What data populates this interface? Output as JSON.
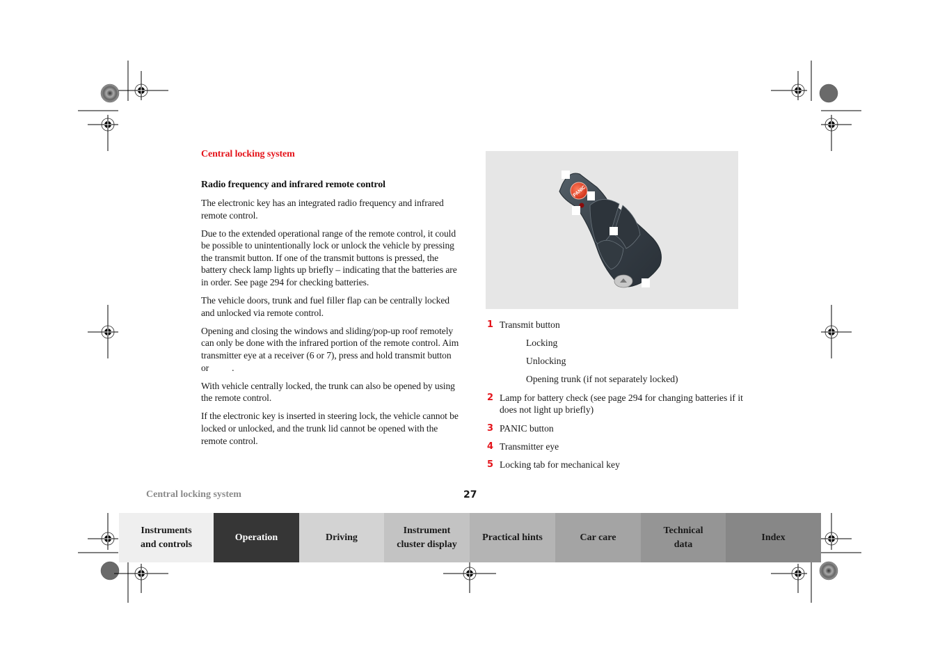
{
  "section_title": "Central locking system",
  "subheading": "Radio frequency and infrared remote control",
  "paragraphs": [
    "The electronic key has an integrated radio frequency and infrared remote control.",
    "Due to the extended operational range of the remote control, it could be possible to unintentionally lock or unlock the vehicle by pressing the transmit button. If one of the transmit buttons is pressed, the battery check lamp lights up briefly – indicating that the batteries are in order. See page 294 for checking batteries.",
    "The vehicle doors, trunk and fuel filler flap can be centrally locked and unlocked via remote control.",
    "Opening and closing the windows and sliding/pop-up roof remotely can only be done with the infrared portion of the remote control. Aim transmitter eye at a receiver (6 or 7), press and hold transmit button",
    "With vehicle centrally locked, the trunk can also be opened by using the remote control.",
    "If the electronic key is inserted in steering lock, the vehicle cannot be locked or unlocked, and the trunk lid cannot be opened with the remote control."
  ],
  "paragraph4_tail": "or          .",
  "figure": {
    "panic_label": "PANIC",
    "background": "#e6e6e6",
    "key_color": "#3a434c",
    "panic_color": "#e8482e"
  },
  "legend": [
    {
      "num": "1",
      "text": "Transmit button",
      "sub": [
        "Locking",
        "Unlocking",
        "Opening trunk (if not separately locked)"
      ]
    },
    {
      "num": "2",
      "text": "Lamp for battery check (see page 294 for changing batteries if it does not light up briefly)"
    },
    {
      "num": "3",
      "text": "PANIC button"
    },
    {
      "num": "4",
      "text": "Transmitter eye"
    },
    {
      "num": "5",
      "text": "Locking tab for mechanical key"
    }
  ],
  "footer": {
    "running_title": "Central locking system",
    "page_number": "27"
  },
  "nav_tabs": [
    {
      "label": "Instruments and controls",
      "line1": "Instruments",
      "line2": "and controls",
      "bg": "#efefef",
      "fg": "#1a1a1a",
      "active": false
    },
    {
      "label": "Operation",
      "line1": "Operation",
      "line2": "",
      "bg": "#363636",
      "fg": "#ffffff",
      "active": true
    },
    {
      "label": "Driving",
      "line1": "Driving",
      "line2": "",
      "bg": "#d3d3d3",
      "fg": "#1a1a1a",
      "active": false
    },
    {
      "label": "Instrument cluster display",
      "line1": "Instrument",
      "line2": "cluster display",
      "bg": "#c3c3c3",
      "fg": "#1a1a1a",
      "active": false
    },
    {
      "label": "Practical hints",
      "line1": "Practical hints",
      "line2": "",
      "bg": "#b4b4b4",
      "fg": "#1a1a1a",
      "active": false
    },
    {
      "label": "Car care",
      "line1": "Car care",
      "line2": "",
      "bg": "#a4a4a4",
      "fg": "#1a1a1a",
      "active": false
    },
    {
      "label": "Technical data",
      "line1": "Technical",
      "line2": "data",
      "bg": "#959595",
      "fg": "#1a1a1a",
      "active": false
    },
    {
      "label": "Index",
      "line1": "Index",
      "line2": "",
      "bg": "#878787",
      "fg": "#1a1a1a",
      "active": false
    }
  ],
  "accent_color": "#e4141b"
}
